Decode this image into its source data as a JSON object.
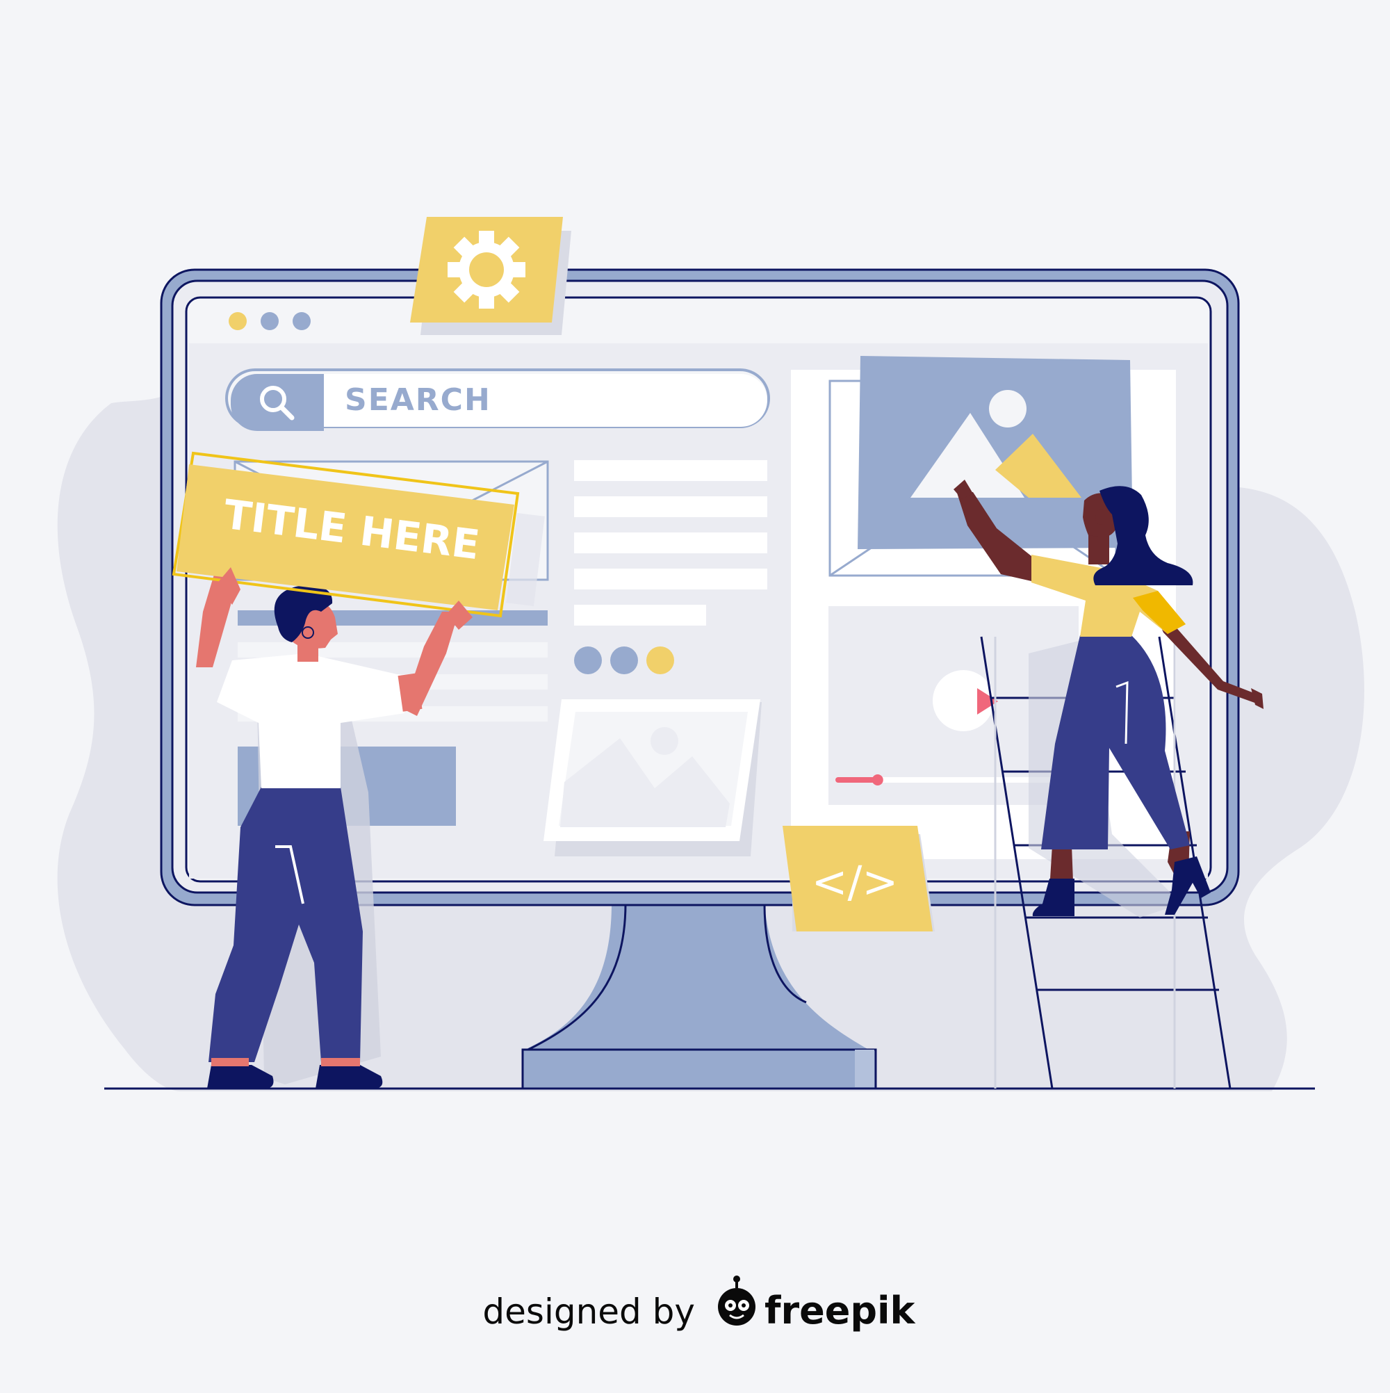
{
  "search": {
    "placeholder": "SEARCH"
  },
  "title_card": {
    "label": "TITLE HERE"
  },
  "code_card": {
    "label": "</>"
  },
  "credit": {
    "prefix": "designed by",
    "brand": "freepik"
  },
  "video": {
    "progress": 0.17
  },
  "colors": {
    "background": "#f4f5f8",
    "navy": "#0d1560",
    "slate": "#97aace",
    "screen": "#ebecf2",
    "yellow": "#f1d06a",
    "indigo": "#363d8a",
    "coral": "#e5766f",
    "pink": "#f0677b"
  },
  "icons": {
    "settings": "gear-icon",
    "search": "search-icon",
    "code": "code-icon",
    "image": "image-placeholder-icon",
    "play": "play-icon",
    "brand": "freepik-logo-icon"
  }
}
